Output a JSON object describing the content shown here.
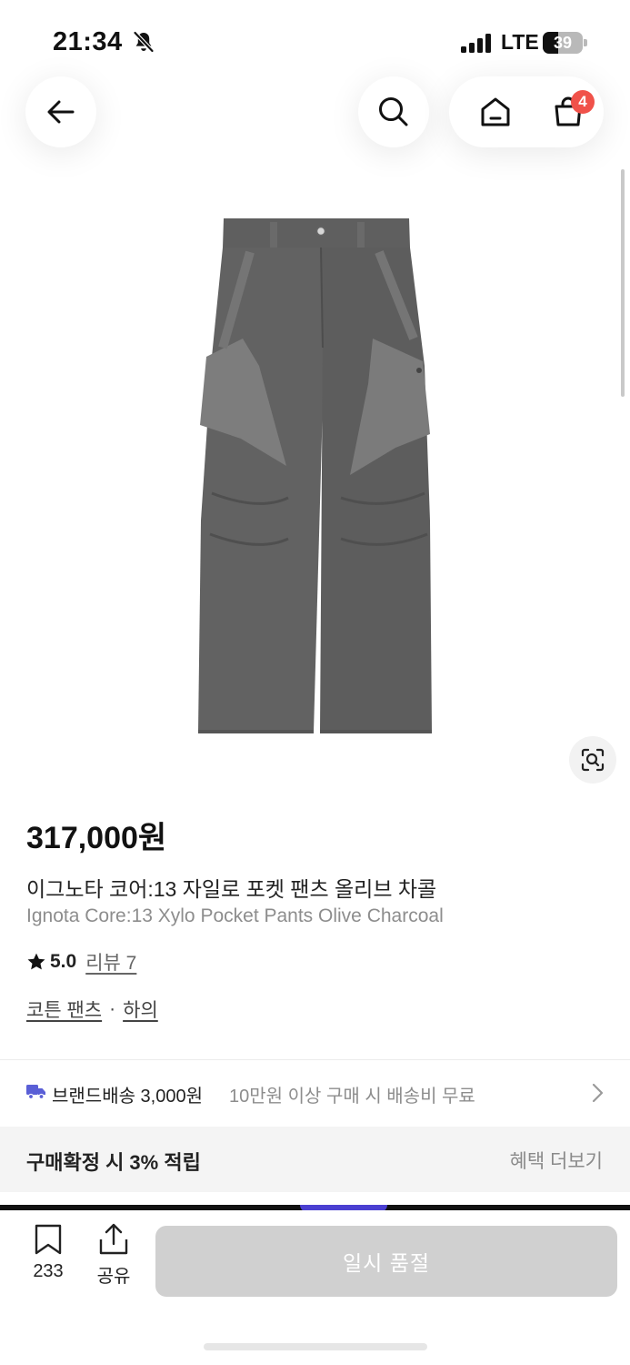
{
  "status_bar": {
    "time": "21:34",
    "network": "LTE",
    "battery": "39",
    "battery_level": 0.39
  },
  "header": {
    "cart_badge": "4",
    "icons": [
      "back-arrow-icon",
      "search-icon",
      "home-icon",
      "shopping-bag-icon"
    ]
  },
  "product": {
    "price": "317,000원",
    "name_ko": "이그노타 코어:13 자일로 포켓 팬츠 올리브 차콜",
    "name_en": "Ignota Core:13 Xylo Pocket Pants Olive Charcoal",
    "rating": "5.0",
    "reviews_label": "리뷰 7",
    "categories": [
      "코튼 팬츠",
      "하의"
    ],
    "category_separator": "·"
  },
  "shipping": {
    "label": "브랜드배송 3,000원",
    "note": "10만원 이상 구매 시 배송비 무료"
  },
  "benefit": {
    "title": "구매확정 시 3% 적립",
    "link": "혜택 더보기"
  },
  "bottom_bar": {
    "bookmark_count": "233",
    "share_label": "공유",
    "cta_label": "일시 품절"
  },
  "colors": {
    "badge": "#f0524a",
    "truck": "#5a5fd6",
    "cta_disabled": "#d0d0d0",
    "benefit_bg": "#f4f4f4"
  }
}
